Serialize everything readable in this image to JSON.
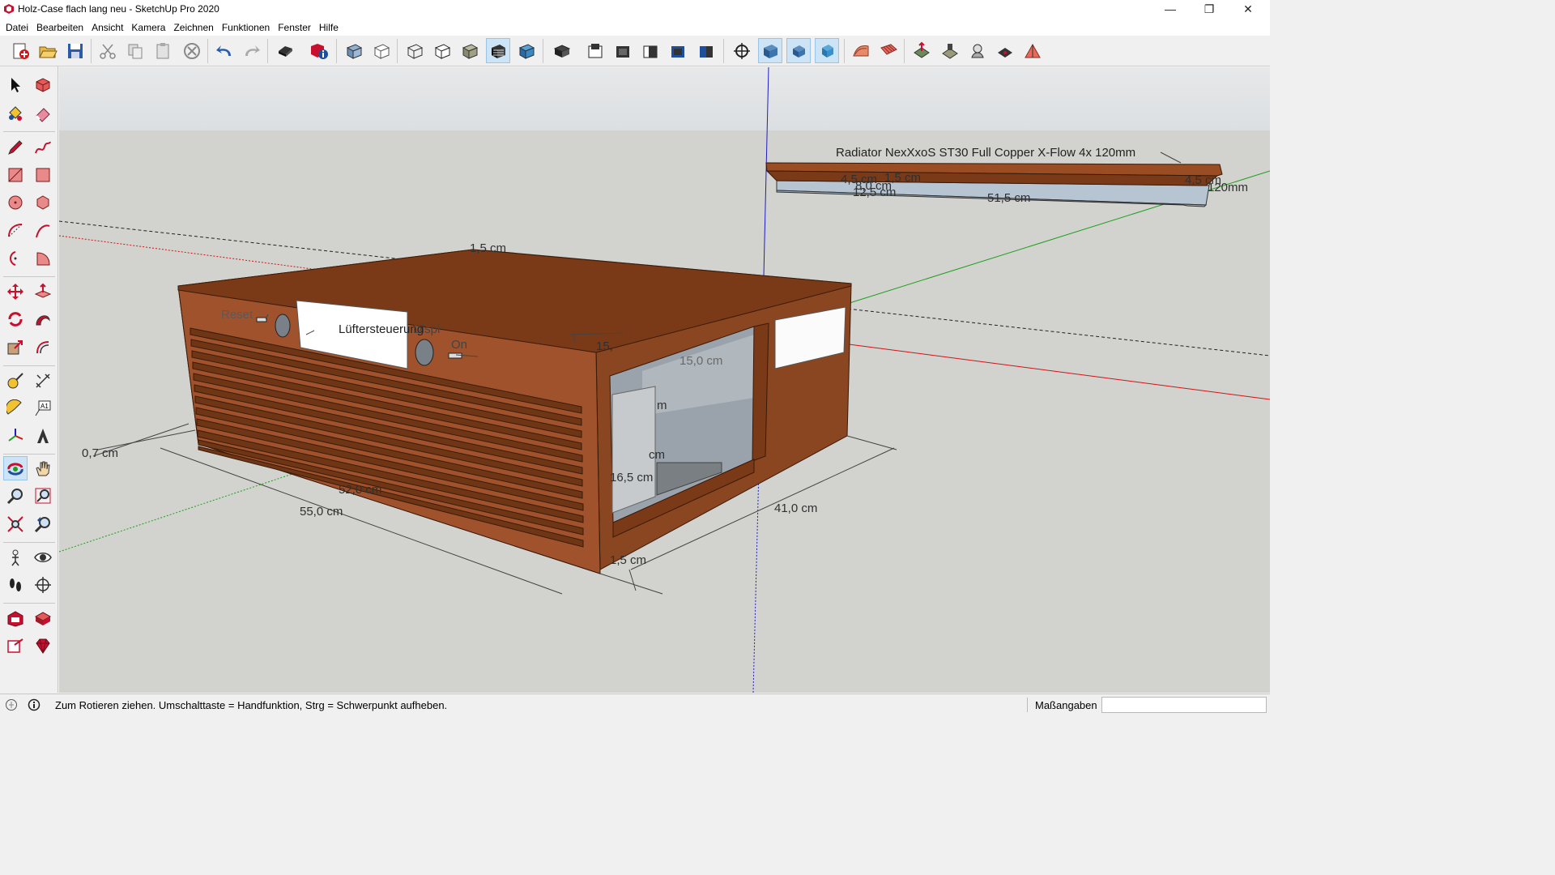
{
  "window": {
    "title": "Holz-Case flach lang neu - SketchUp Pro 2020",
    "minimize": "—",
    "restore": "❐",
    "close": "✕"
  },
  "menu": [
    "Datei",
    "Bearbeiten",
    "Ansicht",
    "Kamera",
    "Zeichnen",
    "Funktionen",
    "Fenster",
    "Hilfe"
  ],
  "model": {
    "radiator_label": "Radiator NexXxoS ST30 Full Copper X-Flow 4x 120mm",
    "front_labels": {
      "reset": "Reset",
      "fan_control": "Lüftersteuerung",
      "fan_control_tail": "Displ",
      "on": "On"
    },
    "dimensions": {
      "top_left": "1,5 cm",
      "radiator_a": "4,5 cm",
      "radiator_b": "1,5 cm",
      "radiator_c": "8,0 cm",
      "radiator_d": "12,5 cm",
      "radiator_e": "12,4 cm",
      "radiator_length": "51,5 cm",
      "radiator_height": "4,5 cm",
      "radiator_fan": "120mm",
      "depth_inner": "15,0 cm",
      "inner_a": "15,",
      "inner_b": "m",
      "inner_c": "cm",
      "height_inner": "16,5 cm",
      "panel_thickness": "0,7 cm",
      "length_inner": "52,0 cm",
      "length_outer": "55,0 cm",
      "depth_outer": "41,0 cm",
      "bottom_thickness": "1,5 cm"
    }
  },
  "statusbar": {
    "message": "Zum Rotieren ziehen. Umschalttaste = Handfunktion, Strg = Schwerpunkt aufheben.",
    "measurements_label": "Maßangaben",
    "measurements_value": ""
  },
  "colors": {
    "wood": "#a0522d",
    "wood_dark": "#6f3615",
    "glass": "#b7c5d2",
    "sky": "#dfe3e4",
    "ground": "#d2d2ce",
    "axis_red": "#d21414",
    "axis_green": "#1ea01e",
    "axis_blue": "#1e1ec8",
    "tool_active": "#cde4f7"
  }
}
